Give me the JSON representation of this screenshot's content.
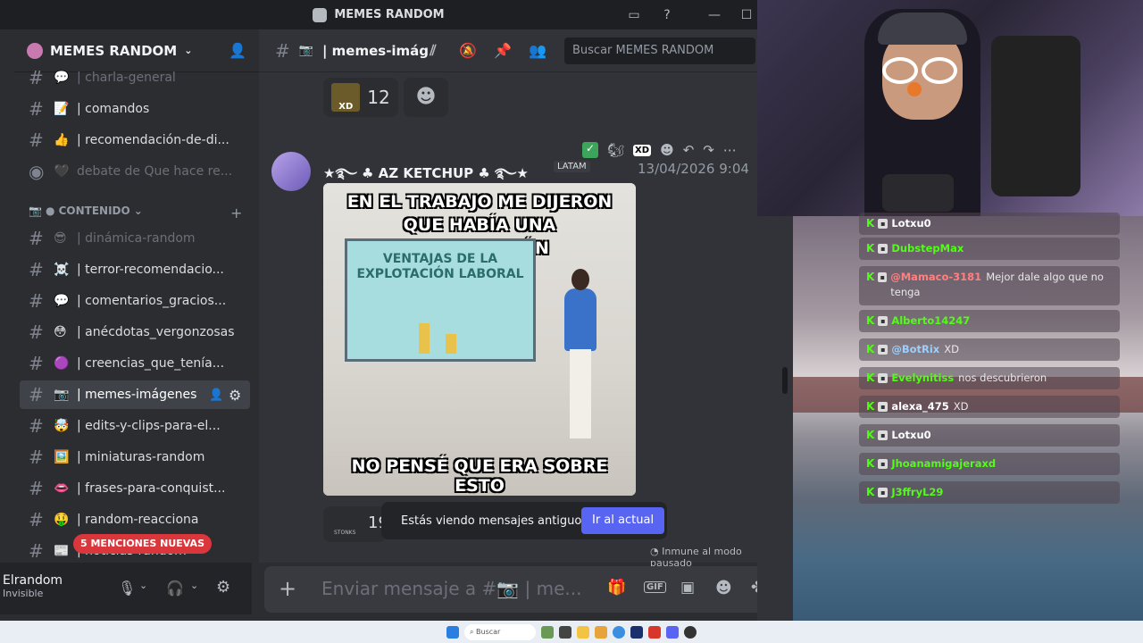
{
  "window": {
    "title": "MEMES RANDOM"
  },
  "server": {
    "name": "MEMES RANDOM"
  },
  "channels": [
    {
      "emoji": "💬",
      "name": "| charla-general",
      "muted": true,
      "dot": false
    },
    {
      "emoji": "📝",
      "name": "| comandos",
      "muted": false,
      "dot": true
    },
    {
      "emoji": "👍",
      "name": "| recomendación-de-di...",
      "muted": false,
      "dot": true
    },
    {
      "emoji": "🖤",
      "name": "debate de Que hace re...",
      "muted": true,
      "dot": false,
      "voice": true
    },
    {
      "emoji": "😎",
      "name": "| dinámica-random",
      "muted": true,
      "dot": false
    },
    {
      "emoji": "☠️",
      "name": "| terror-recomendacio...",
      "muted": false,
      "dot": true
    },
    {
      "emoji": "💬",
      "name": "| comentarios_gracios...",
      "muted": false,
      "dot": true
    },
    {
      "emoji": "😳",
      "name": "| anécdotas_vergonzosas",
      "muted": false,
      "dot": true
    },
    {
      "emoji": "🟣",
      "name": "| creencias_que_tenía...",
      "muted": false,
      "dot": true
    },
    {
      "emoji": "📷",
      "name": "| memes-imágenes",
      "active": true
    },
    {
      "emoji": "🤯",
      "name": "| edits-y-clips-para-el...",
      "muted": false,
      "dot": true
    },
    {
      "emoji": "🖼️",
      "name": "| miniaturas-random",
      "muted": false,
      "dot": true
    },
    {
      "emoji": "👄",
      "name": "| frases-para-conquist...",
      "muted": false,
      "dot": true
    },
    {
      "emoji": "🤑",
      "name": "| random-reacciona",
      "muted": false,
      "dot": true
    },
    {
      "emoji": "📰",
      "name": "| noticias-random",
      "muted": false,
      "dot": true
    }
  ],
  "category": {
    "label": "● CONTENIDO"
  },
  "mentions_pill": "5 MENCIONES NUEVAS",
  "user": {
    "name": "Elrandom",
    "status": "Invisible"
  },
  "chat": {
    "channel_label": "| memes-imág",
    "search_placeholder": "Buscar MEMES RANDOM",
    "reaction_count": "12",
    "author": "★࿐ ♣ AZ KETCHUP ♣ ࿐★",
    "tag": "LATAM",
    "timestamp": "13/04/2026 9:04",
    "meme_top": "EN EL TRABAJO ME DIJERON QUE HABÍA UNA CAPACITACIÓN",
    "meme_slide": "VENTAJAS DE LA EXPLOTACIÓN LABORAL",
    "meme_bottom": "NO PENSÉ QUE ERA SOBRE ESTO",
    "old_msgs_notice": "Estás viendo mensajes antiguos",
    "jump_button": "Ir al actual",
    "immune_note": "Inmune al modo pausado",
    "composer_placeholder": "Enviar mensaje a #📷 | me...",
    "stonks_label": "STONKS",
    "reaction2_count": "19"
  },
  "stream_chat": [
    {
      "user": "Lotxu0",
      "text": "",
      "color": "#ffffff"
    },
    {
      "user": "DubstepMax",
      "text": "",
      "color": "#53fc18"
    },
    {
      "user": "@Mamaco-3181",
      "text": "Mejor dale algo que no tenga",
      "color": "#ff8080"
    },
    {
      "user": "Alberto14247",
      "text": "",
      "color": "#53fc18"
    },
    {
      "user": "@BotRix",
      "text": "XD",
      "color": "#9ad0ff"
    },
    {
      "user": "Evelynitiss",
      "text": "nos descubrieron",
      "color": "#53fc18"
    },
    {
      "user": "alexa_475",
      "text": "XD",
      "color": "#ffffff"
    },
    {
      "user": "Lotxu0",
      "text": "",
      "color": "#ffffff"
    },
    {
      "user": "Jhoanamigajeraxd",
      "text": "",
      "color": "#53fc18"
    },
    {
      "user": "J3ffryL29",
      "text": "",
      "color": "#53fc18"
    }
  ],
  "taskbar": {
    "search": "Buscar"
  }
}
